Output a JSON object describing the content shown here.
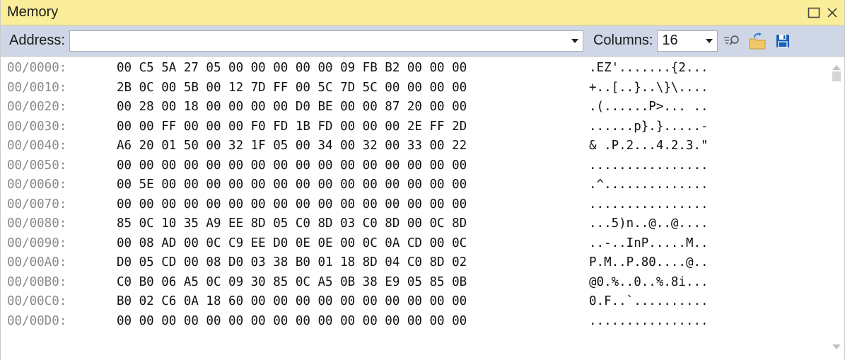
{
  "window": {
    "title": "Memory"
  },
  "toolbar": {
    "address_label": "Address:",
    "address_value": "",
    "columns_label": "Columns:",
    "columns_value": "16"
  },
  "icons": {
    "restore": "restore-window-icon",
    "close": "close-icon",
    "address_dropdown": "chevron-down-icon",
    "columns_dropdown": "chevron-down-icon",
    "reevaluate": "reevaluate-icon",
    "reload": "reload-icon",
    "save": "save-icon"
  },
  "colors": {
    "title_bar": "#fbee9a",
    "toolbar": "#cfd6e5",
    "address_text": "#8a8a8a"
  },
  "rows": [
    {
      "address": "00/0000:",
      "hex": "00 C5 5A 27 05 00 00 00 00 00 09 FB B2 00 00 00",
      "ascii": ".EZ'.......{2..."
    },
    {
      "address": "00/0010:",
      "hex": "2B 0C 00 5B 00 12 7D FF 00 5C 7D 5C 00 00 00 00",
      "ascii": "+..[..}..\\}\\...."
    },
    {
      "address": "00/0020:",
      "hex": "00 28 00 18 00 00 00 00 D0 BE 00 00 87 20 00 00",
      "ascii": ".(......P>... .."
    },
    {
      "address": "00/0030:",
      "hex": "00 00 FF 00 00 00 F0 FD 1B FD 00 00 00 2E FF 2D",
      "ascii": "......p}.}.....-"
    },
    {
      "address": "00/0040:",
      "hex": "A6 20 01 50 00 32 1F 05 00 34 00 32 00 33 00 22",
      "ascii": "& .P.2...4.2.3.\""
    },
    {
      "address": "00/0050:",
      "hex": "00 00 00 00 00 00 00 00 00 00 00 00 00 00 00 00",
      "ascii": "................"
    },
    {
      "address": "00/0060:",
      "hex": "00 5E 00 00 00 00 00 00 00 00 00 00 00 00 00 00",
      "ascii": ".^.............."
    },
    {
      "address": "00/0070:",
      "hex": "00 00 00 00 00 00 00 00 00 00 00 00 00 00 00 00",
      "ascii": "................"
    },
    {
      "address": "00/0080:",
      "hex": "85 0C 10 35 A9 EE 8D 05 C0 8D 03 C0 8D 00 0C 8D",
      "ascii": "...5)n..@..@...."
    },
    {
      "address": "00/0090:",
      "hex": "00 08 AD 00 0C C9 EE D0 0E 0E 00 0C 0A CD 00 0C",
      "ascii": "..-..InP.....M.."
    },
    {
      "address": "00/00A0:",
      "hex": "D0 05 CD 00 08 D0 03 38 B0 01 18 8D 04 C0 8D 02",
      "ascii": "P.M..P.80....@.."
    },
    {
      "address": "00/00B0:",
      "hex": "C0 B0 06 A5 0C 09 30 85 0C A5 0B 38 E9 05 85 0B",
      "ascii": "@0.%..0..%.8i..."
    },
    {
      "address": "00/00C0:",
      "hex": "B0 02 C6 0A 18 60 00 00 00 00 00 00 00 00 00 00",
      "ascii": "0.F..`.........."
    },
    {
      "address": "00/00D0:",
      "hex": "00 00 00 00 00 00 00 00 00 00 00 00 00 00 00 00",
      "ascii": "................"
    }
  ]
}
